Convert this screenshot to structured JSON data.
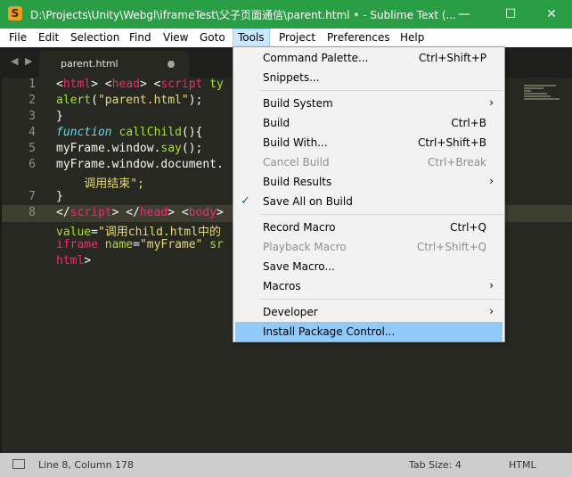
{
  "window": {
    "title": "D:\\Projects\\Unity\\Webgl\\iframeTest\\父子页面通信\\parent.html • - Sublime Text (...",
    "app_icon_glyph": "S",
    "minimize_glyph": "—",
    "maximize_glyph": "☐",
    "close_glyph": "✕"
  },
  "menubar": {
    "items": [
      "File",
      "Edit",
      "Selection",
      "Find",
      "View",
      "Goto",
      "Tools",
      "Project",
      "Preferences",
      "Help"
    ]
  },
  "tabbar": {
    "nav_glyph": "◀ ▶",
    "tab_name": "parent.html"
  },
  "editor": {
    "line_numbers": [
      "1",
      "2",
      "3",
      "4",
      "5",
      "6",
      "7",
      "8"
    ],
    "lines": {
      "l1a": "<",
      "l1b": "html",
      "l1c": "> <",
      "l1d": "head",
      "l1e": "> <",
      "l1f": "script",
      "l1g": " ty",
      "l2a": "alert",
      "l2b": "(",
      "l2c": "\"parent.html\"",
      "l2d": ");",
      "l3": "}",
      "l4a": "function",
      "l4b": " ",
      "l4c": "callChild",
      "l4d": "(){",
      "l5a": "myFrame.window.",
      "l5b": "say",
      "l5c": "();",
      "l6a": "myFrame.window.document.",
      "l6b": "    调用结束\";",
      "l7": "}",
      "l8a": "</",
      "l8b": "script",
      "l8c": "> </",
      "l8d": "head",
      "l8e": "> <",
      "l8f": "body",
      "l8g": ">",
      "l9a": "value",
      "l9b": "=",
      "l9c": "\"调用child.html中的",
      "l10a": "iframe",
      "l10b": " ",
      "l10c": "name",
      "l10d": "=",
      "l10e": "\"myFrame\"",
      "l10f": " ",
      "l10g": "sr",
      "l11a": "html",
      "l11b": ">"
    }
  },
  "tools_menu": {
    "command_palette": {
      "label": "Command Palette...",
      "shortcut": "Ctrl+Shift+P"
    },
    "snippets": {
      "label": "Snippets..."
    },
    "build_system": {
      "label": "Build System",
      "arrow": "›"
    },
    "build": {
      "label": "Build",
      "shortcut": "Ctrl+B"
    },
    "build_with": {
      "label": "Build With...",
      "shortcut": "Ctrl+Shift+B"
    },
    "cancel_build": {
      "label": "Cancel Build",
      "shortcut": "Ctrl+Break"
    },
    "build_results": {
      "label": "Build Results",
      "arrow": "›"
    },
    "save_all_on_build": {
      "label": "Save All on Build",
      "check": "✓"
    },
    "record_macro": {
      "label": "Record Macro",
      "shortcut": "Ctrl+Q"
    },
    "playback_macro": {
      "label": "Playback Macro",
      "shortcut": "Ctrl+Shift+Q"
    },
    "save_macro": {
      "label": "Save Macro..."
    },
    "macros": {
      "label": "Macros",
      "arrow": "›"
    },
    "developer": {
      "label": "Developer",
      "arrow": "›"
    },
    "install_package_control": {
      "label": "Install Package Control..."
    }
  },
  "statusbar": {
    "position": "Line 8, Column 178",
    "tab_size": "Tab Size: 4",
    "syntax": "HTML"
  },
  "colors": {
    "titlebar": "#2a9e44",
    "editor_bg": "#272822",
    "menu_highlight": "#91c9f7",
    "tag": "#f92672",
    "string": "#e6db74",
    "function": "#a6e22e",
    "keyword": "#66d9ef"
  }
}
